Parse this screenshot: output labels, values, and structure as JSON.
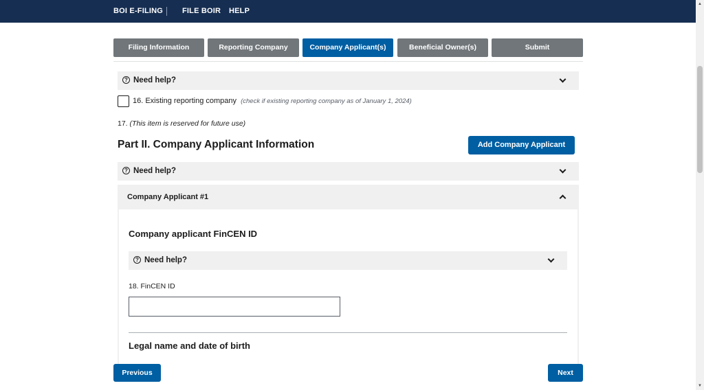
{
  "topnav": {
    "items": [
      "BOI E-FILING",
      "FILE BOIR",
      "HELP"
    ]
  },
  "steps": [
    {
      "label": "Filing Information",
      "active": false
    },
    {
      "label": "Reporting Company",
      "active": false
    },
    {
      "label": "Company Applicant(s)",
      "active": true
    },
    {
      "label": "Beneficial Owner(s)",
      "active": false
    },
    {
      "label": "Submit",
      "active": false
    }
  ],
  "help": {
    "label": "Need help?",
    "icon": "question-circle-icon"
  },
  "existing_company": {
    "label": "16. Existing reporting company",
    "hint": "(check if existing reporting company as of January 1, 2024)"
  },
  "item17": {
    "prefix": "17.",
    "text": "(This item is reserved for future use)"
  },
  "part2": {
    "title": "Part II. Company Applicant Information",
    "add_button": "Add Company Applicant"
  },
  "applicant": {
    "header": "Company Applicant #1",
    "fincen_section_title": "Company applicant FinCEN ID",
    "fincen_label": "18. FinCEN ID",
    "fincen_value": "",
    "legal_section_title": "Legal name and date of birth"
  },
  "footer": {
    "previous": "Previous",
    "next": "Next"
  },
  "colors": {
    "nav_bg": "#162e51",
    "primary": "#005ea2",
    "step_inactive": "#71767a",
    "help_bg": "#f0f0f0"
  }
}
